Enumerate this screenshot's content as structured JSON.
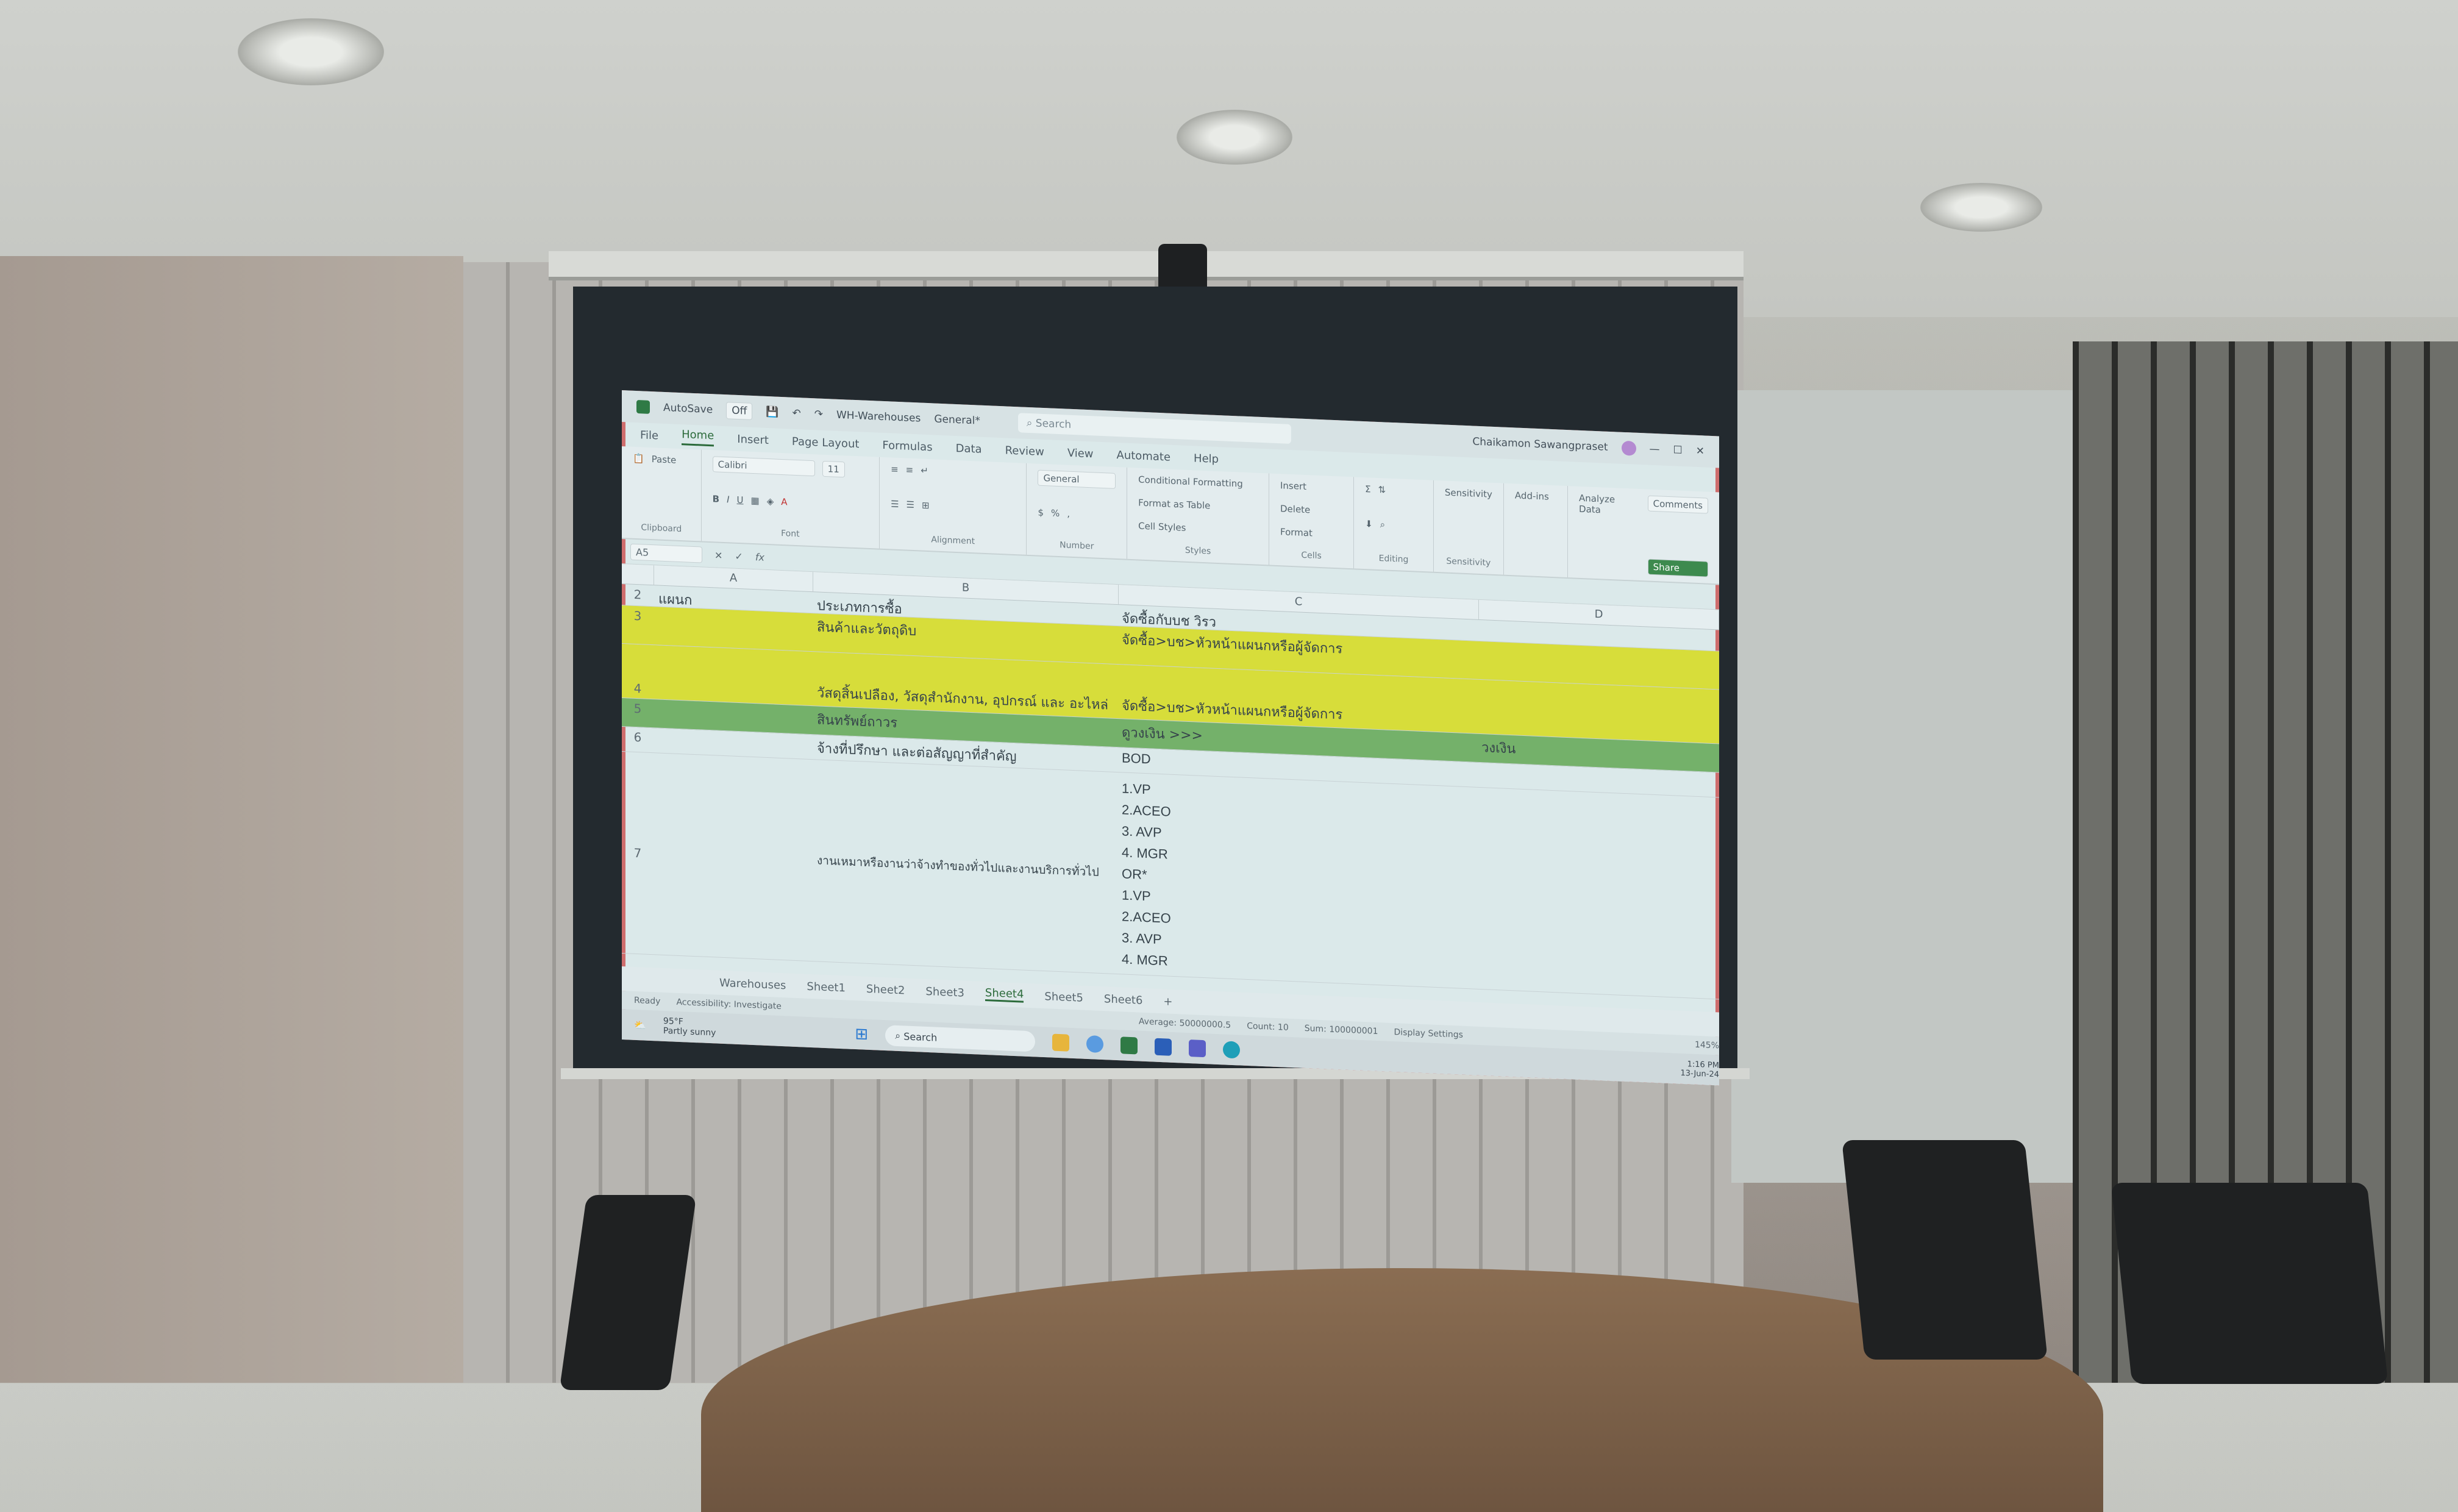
{
  "window": {
    "autosave": "AutoSave",
    "autosave_state": "Off",
    "file_name": "WH-Warehouses",
    "sensitivity": "General*",
    "search_placeholder": "Search",
    "user_name": "Chaikamon Sawangpraset"
  },
  "ribbon_tabs": [
    "File",
    "Home",
    "Insert",
    "Page Layout",
    "Formulas",
    "Data",
    "Review",
    "View",
    "Automate",
    "Help"
  ],
  "active_tab": "Home",
  "ribbon": {
    "clipboard": {
      "paste": "Paste",
      "label": "Clipboard"
    },
    "font": {
      "name": "Calibri",
      "size": "11",
      "label": "Font"
    },
    "alignment": {
      "label": "Alignment"
    },
    "number": {
      "format": "General",
      "label": "Number"
    },
    "styles": {
      "conditional": "Conditional Formatting",
      "table": "Format as Table",
      "cell": "Cell Styles",
      "label": "Styles"
    },
    "cells": {
      "insert": "Insert",
      "delete": "Delete",
      "format": "Format",
      "label": "Cells"
    },
    "editing": {
      "label": "Editing"
    },
    "sensitivity": {
      "btn": "Sensitivity",
      "label": "Sensitivity"
    },
    "addins": {
      "btn": "Add-ins",
      "label": "Add-ins"
    },
    "analyze": {
      "btn": "Analyze Data"
    },
    "comments": "Comments",
    "share": "Share"
  },
  "formula_bar": {
    "name_box": "A5",
    "fx": "fx"
  },
  "columns": [
    "A",
    "B",
    "C",
    "D"
  ],
  "rows": [
    {
      "num": "2",
      "a": "แผนก",
      "b": "ประเภทการซื้อ",
      "c": "จัดซื้อกับบช วิรว",
      "d": ""
    },
    {
      "num": "3",
      "a": "",
      "b": "สินค้าและวัตถุดิบ",
      "c": "จัดซื้อ>บช>หัวหน้าแผนกหรือผู้จัดการ",
      "d": ""
    },
    {
      "num": "4",
      "a": "",
      "b": "วัสดุสิ้นเปลือง, วัสดุสำนักงาน, อุปกรณ์ และ อะไหล่",
      "c": "จัดซื้อ>บช>หัวหน้าแผนกหรือผู้จัดการ",
      "d": ""
    },
    {
      "num": "5",
      "a": "",
      "b": "สินทรัพย์ถาวร",
      "c": "ดูวงเงิน >>>",
      "d": "วงเงิน"
    },
    {
      "num": "6",
      "a": "",
      "b": "จ้างที่ปรึกษา และต่อสัญญาที่สำคัญ",
      "c": "BOD",
      "d": ""
    },
    {
      "num": "7",
      "a": "",
      "b": "งานเหมาหรืองานว่าจ้างทำของทั่วไปและงานบริการทั่วไป",
      "c_lines": [
        "1.VP",
        "2.ACEO",
        "3. AVP",
        "4. MGR",
        "OR*",
        "1.VP",
        "2.ACEO",
        "3. AVP",
        "4. MGR"
      ],
      "d": ""
    }
  ],
  "sheet_tabs": [
    "Warehouses",
    "Sheet1",
    "Sheet2",
    "Sheet3",
    "Sheet4",
    "Sheet5",
    "Sheet6"
  ],
  "active_sheet": "Sheet4",
  "status": {
    "ready": "Ready",
    "accessibility": "Accessibility: Investigate",
    "average": "Average: 50000000.5",
    "count": "Count: 10",
    "sum": "Sum: 100000001",
    "display": "Display Settings",
    "zoom": "145%"
  },
  "taskbar": {
    "weather_temp": "95°F",
    "weather_desc": "Partly sunny",
    "search": "Search",
    "time": "1:16 PM",
    "date": "13-Jun-24"
  },
  "colors": {
    "yellow_row": "#d7dd3a",
    "green_row": "#74b16a",
    "accent": "#2c6b3b",
    "border": "#cf6d6d"
  }
}
